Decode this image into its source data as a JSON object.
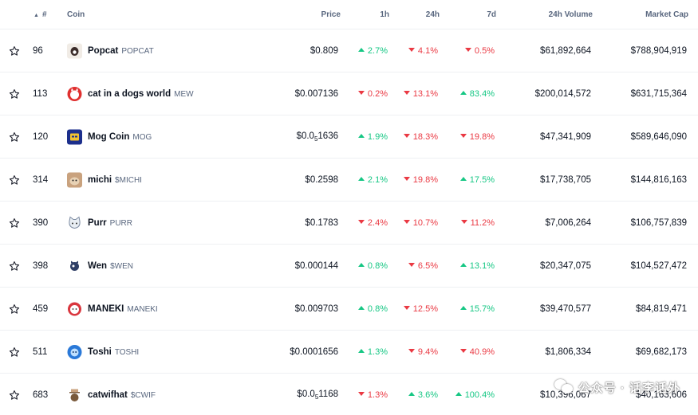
{
  "header": {
    "rank": "#",
    "coin": "Coin",
    "price": "Price",
    "h1": "1h",
    "h24": "24h",
    "d7": "7d",
    "volume": "24h Volume",
    "market_cap": "Market Cap",
    "sort_icon": "▲"
  },
  "rows": [
    {
      "rank": "96",
      "name": "Popcat",
      "symbol": "POPCAT",
      "price": "$0.809",
      "h1": "2.7%",
      "h1_dir": "up",
      "h24": "4.1%",
      "h24_dir": "down",
      "d7": "0.5%",
      "d7_dir": "down",
      "volume": "$61,892,664",
      "market_cap": "$788,904,919",
      "logo": "popcat-logo",
      "logo_color": "#f1ece6"
    },
    {
      "rank": "113",
      "name": "cat in a dogs world",
      "symbol": "MEW",
      "price": "$0.007136",
      "h1": "0.2%",
      "h1_dir": "down",
      "h24": "13.1%",
      "h24_dir": "down",
      "d7": "83.4%",
      "d7_dir": "up",
      "volume": "$200,014,572",
      "market_cap": "$631,715,364",
      "logo": "mew-logo",
      "logo_color": "#e0302f"
    },
    {
      "rank": "120",
      "name": "Mog Coin",
      "symbol": "MOG",
      "price_prefix": "$0.0",
      "price_sub": "5",
      "price_suffix": "1636",
      "h1": "1.9%",
      "h1_dir": "up",
      "h24": "18.3%",
      "h24_dir": "down",
      "d7": "19.8%",
      "d7_dir": "down",
      "volume": "$47,341,909",
      "market_cap": "$589,646,090",
      "logo": "mog-logo",
      "logo_color": "#1c2f8c"
    },
    {
      "rank": "314",
      "name": "michi",
      "symbol": "$MICHI",
      "price": "$0.2598",
      "h1": "2.1%",
      "h1_dir": "up",
      "h24": "19.8%",
      "h24_dir": "down",
      "d7": "17.5%",
      "d7_dir": "up",
      "volume": "$17,738,705",
      "market_cap": "$144,816,163",
      "logo": "michi-logo",
      "logo_color": "#c9a27e"
    },
    {
      "rank": "390",
      "name": "Purr",
      "symbol": "PURR",
      "price": "$0.1783",
      "h1": "2.4%",
      "h1_dir": "down",
      "h24": "10.7%",
      "h24_dir": "down",
      "d7": "11.2%",
      "d7_dir": "down",
      "volume": "$7,006,264",
      "market_cap": "$106,757,839",
      "logo": "purr-logo",
      "logo_color": "#e9eef3"
    },
    {
      "rank": "398",
      "name": "Wen",
      "symbol": "$WEN",
      "price": "$0.000144",
      "h1": "0.8%",
      "h1_dir": "up",
      "h24": "6.5%",
      "h24_dir": "down",
      "d7": "13.1%",
      "d7_dir": "up",
      "volume": "$20,347,075",
      "market_cap": "$104,527,472",
      "logo": "wen-logo",
      "logo_color": "#2f3f66"
    },
    {
      "rank": "459",
      "name": "MANEKI",
      "symbol": "MANEKI",
      "price": "$0.009703",
      "h1": "0.8%",
      "h1_dir": "up",
      "h24": "12.5%",
      "h24_dir": "down",
      "d7": "15.7%",
      "d7_dir": "up",
      "volume": "$39,470,577",
      "market_cap": "$84,819,471",
      "logo": "maneki-logo",
      "logo_color": "#d9363e"
    },
    {
      "rank": "511",
      "name": "Toshi",
      "symbol": "TOSHI",
      "price": "$0.0001656",
      "h1": "1.3%",
      "h1_dir": "up",
      "h24": "9.4%",
      "h24_dir": "down",
      "d7": "40.9%",
      "d7_dir": "down",
      "volume": "$1,806,334",
      "market_cap": "$69,682,173",
      "logo": "toshi-logo",
      "logo_color": "#2a79d8"
    },
    {
      "rank": "683",
      "name": "catwifhat",
      "symbol": "$CWIF",
      "price_prefix": "$0.0",
      "price_sub": "5",
      "price_suffix": "1168",
      "h1": "1.3%",
      "h1_dir": "down",
      "h24": "3.6%",
      "h24_dir": "up",
      "d7": "100.4%",
      "d7_dir": "up",
      "volume": "$10,396,067",
      "market_cap": "$40,163,606",
      "logo": "catwifhat-logo",
      "logo_color": "#7a5a3c"
    }
  ],
  "watermark": {
    "text": "公众号 · 话李话外"
  }
}
